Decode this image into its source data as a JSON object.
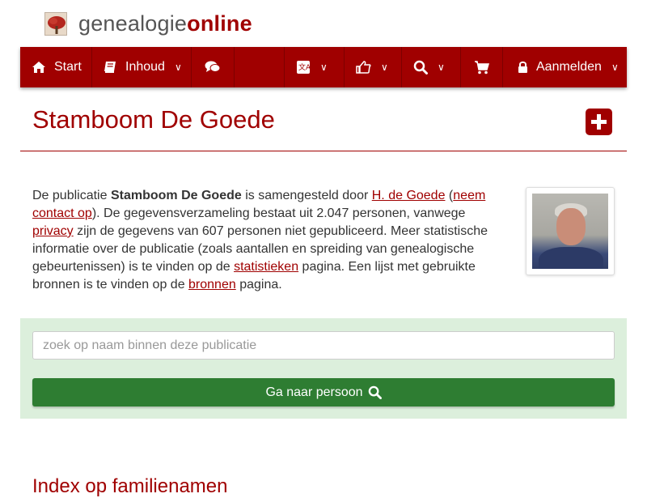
{
  "logo": {
    "part1": "genealogie",
    "part2": "online"
  },
  "nav": {
    "start": "Start",
    "inhoud": "Inhoud",
    "login": "Aanmelden",
    "chevron": "∨"
  },
  "page": {
    "title": "Stamboom De Goede",
    "intro": {
      "t1": "De publicatie ",
      "pub": "Stamboom De Goede",
      "t2": " is samengesteld door ",
      "author": "H. de Goede",
      "t3": " (",
      "contact": "neem contact op",
      "t4": "). De gegevensverzameling bestaat uit 2.047 personen, vanwege ",
      "privacy": "privacy",
      "t5": " zijn de gegevens van 607 personen niet gepubliceerd. Meer statistische informatie over de publicatie (zoals aantallen en spreiding van genealogische gebeurtenissen) is te vinden op de ",
      "stats": "statistieken",
      "t6": " pagina. Een lijst met gebruikte bronnen is te vinden op de ",
      "sources": "bronnen",
      "t7": " pagina."
    }
  },
  "search": {
    "placeholder": "zoek op naam binnen deze publicatie",
    "button": "Ga naar persoon"
  },
  "index": {
    "title": "Index op familienamen"
  },
  "colors": {
    "brand": "#a00000",
    "green": "#2e7d32",
    "panel": "#dcefdc"
  }
}
